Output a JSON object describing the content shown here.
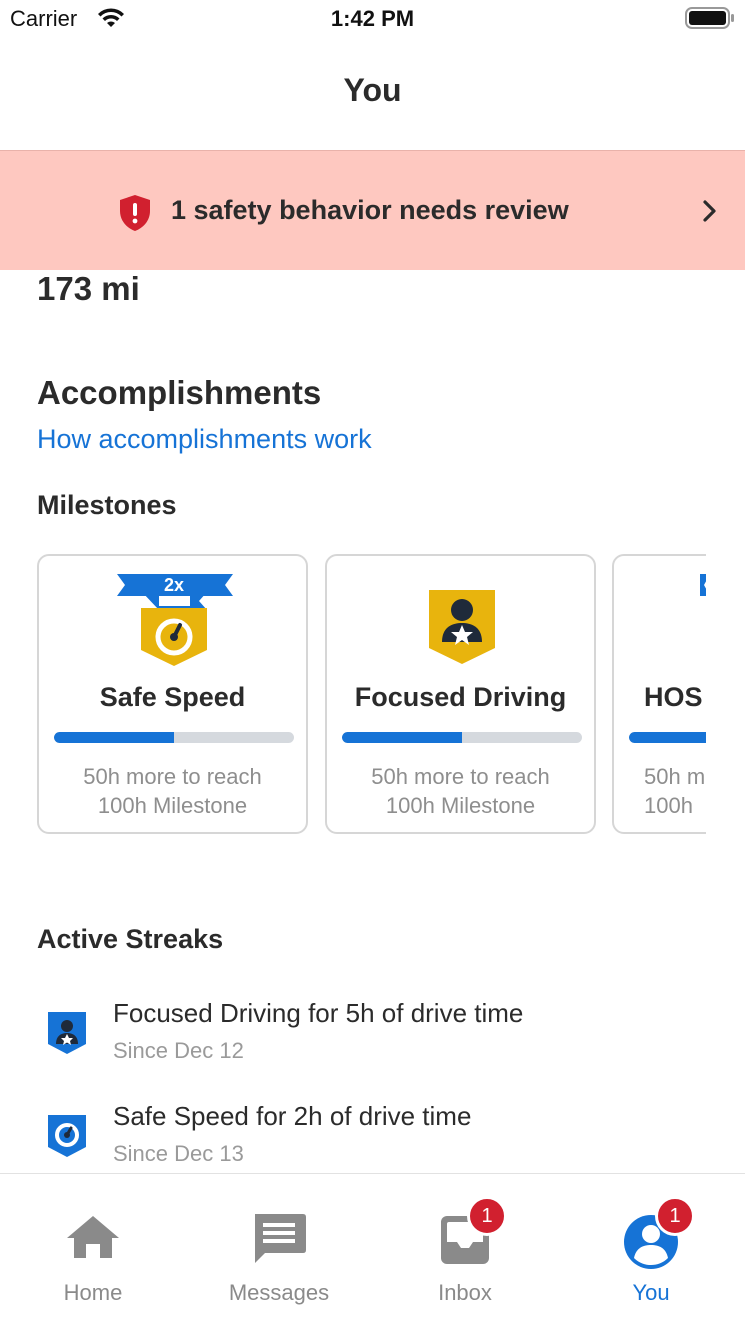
{
  "status_bar": {
    "carrier": "Carrier",
    "time": "1:42 PM"
  },
  "header": {
    "title": "You"
  },
  "banner": {
    "text": "1 safety behavior needs review",
    "color": "#fec8c0"
  },
  "stats": {
    "distance": "173 mi"
  },
  "accomplishments": {
    "title": "Accomplishments",
    "link": "How accomplishments work",
    "milestones_title": "Milestones",
    "cards": [
      {
        "title": "Safe Speed",
        "badge_icon": "speedometer-icon",
        "multiplier": "2x",
        "progress": 0.5,
        "line1": "50h more to reach",
        "line2": "100h Milestone"
      },
      {
        "title": "Focused Driving",
        "badge_icon": "driver-star-icon",
        "progress": 0.5,
        "line1": "50h more to reach",
        "line2": "100h Milestone"
      },
      {
        "title": "HOS",
        "badge_icon": "ribbon-icon",
        "progress": 0.5,
        "line1": "50h m",
        "line2": "100h"
      }
    ]
  },
  "streaks": {
    "title": "Active Streaks",
    "items": [
      {
        "title": "Focused Driving for 5h of drive time",
        "since": "Since Dec 12",
        "icon": "driver-star-icon"
      },
      {
        "title": "Safe Speed for 2h of drive time",
        "since": "Since Dec 13",
        "icon": "speedometer-icon"
      }
    ]
  },
  "tabbar": {
    "tabs": [
      {
        "label": "Home",
        "icon": "home-icon"
      },
      {
        "label": "Messages",
        "icon": "message-icon"
      },
      {
        "label": "Inbox",
        "icon": "inbox-icon",
        "badge": "1"
      },
      {
        "label": "You",
        "icon": "profile-icon",
        "badge": "1",
        "active": true
      }
    ]
  },
  "colors": {
    "accent": "#1673d6",
    "badge_gold": "#e8b40d",
    "alert_red": "#d1202f"
  }
}
